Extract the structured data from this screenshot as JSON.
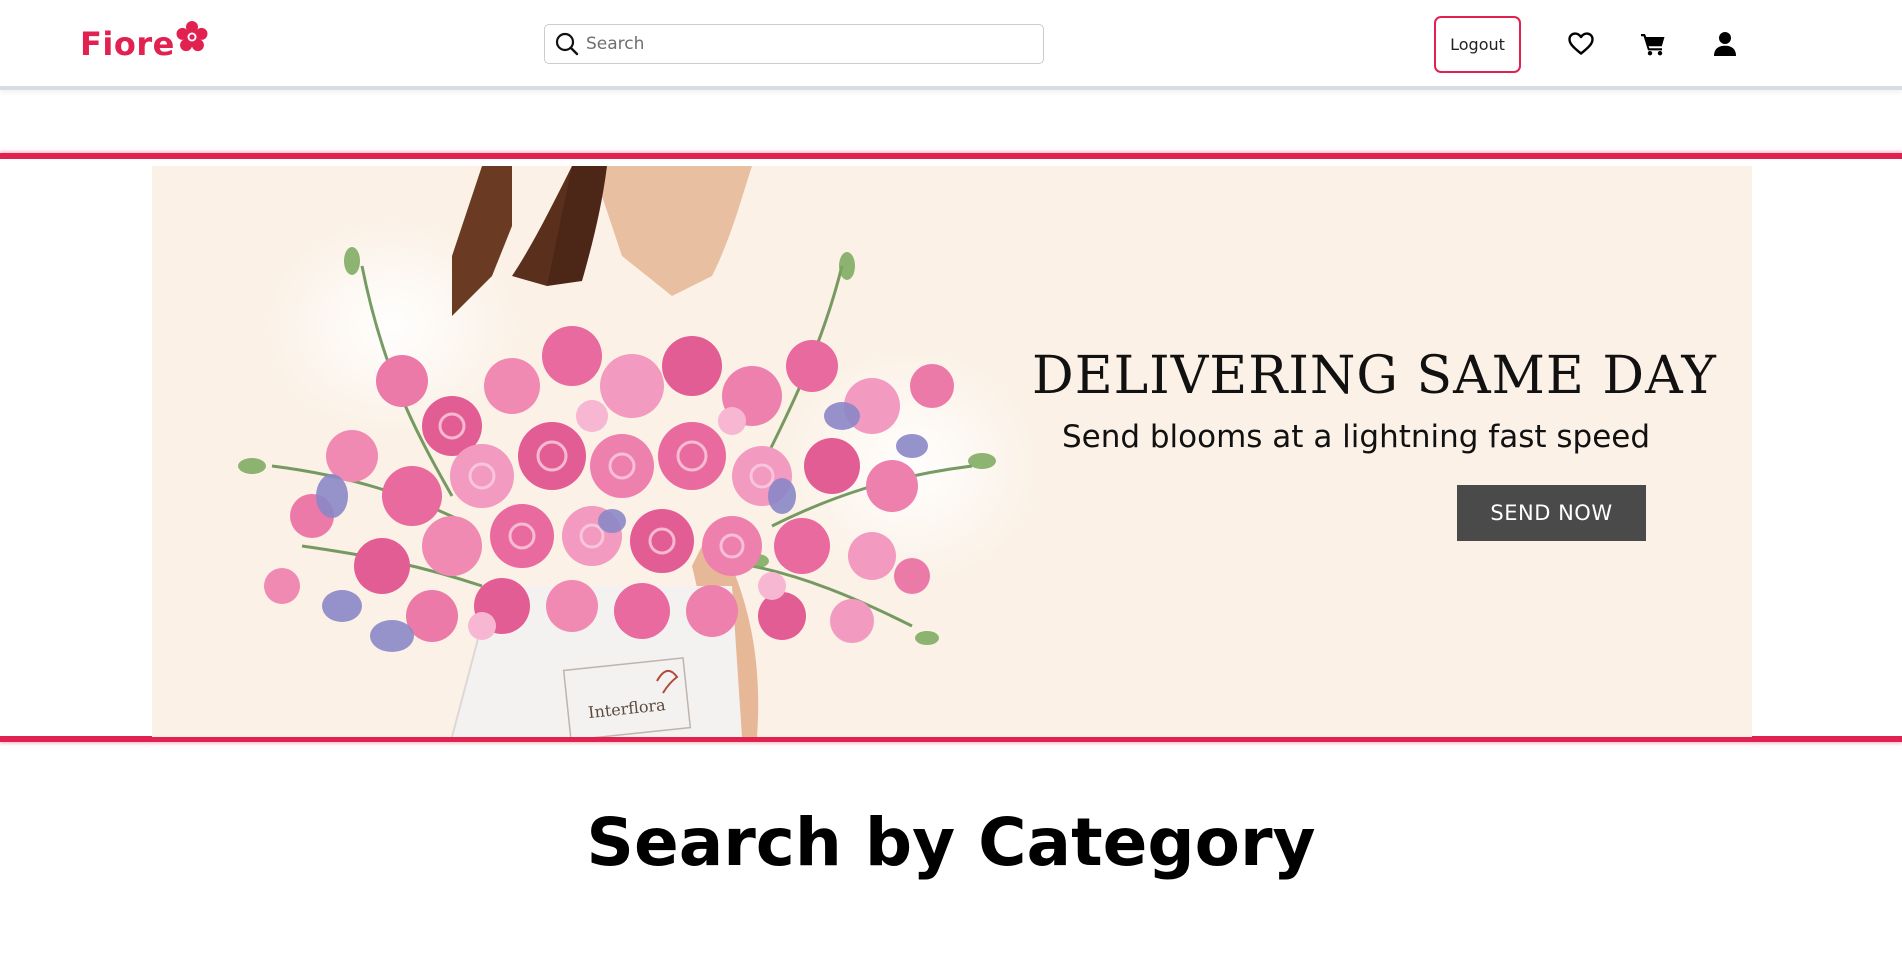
{
  "header": {
    "logo_text": "Fiore",
    "search": {
      "placeholder": "Search",
      "value": ""
    },
    "logout_label": "Logout",
    "icons": [
      "heart-icon",
      "cart-icon",
      "user-icon"
    ]
  },
  "hero": {
    "headline": "DELIVERING SAME DAY",
    "subheadline": "Send blooms at a lightning fast speed",
    "cta_label": "SEND NOW",
    "box_brand": "Interflora"
  },
  "sections": {
    "category_title": "Search by Category"
  },
  "colors": {
    "brand": "#e1214f",
    "banner_bg": "#fbf1e6",
    "cta_bg": "#4a4a4a"
  }
}
